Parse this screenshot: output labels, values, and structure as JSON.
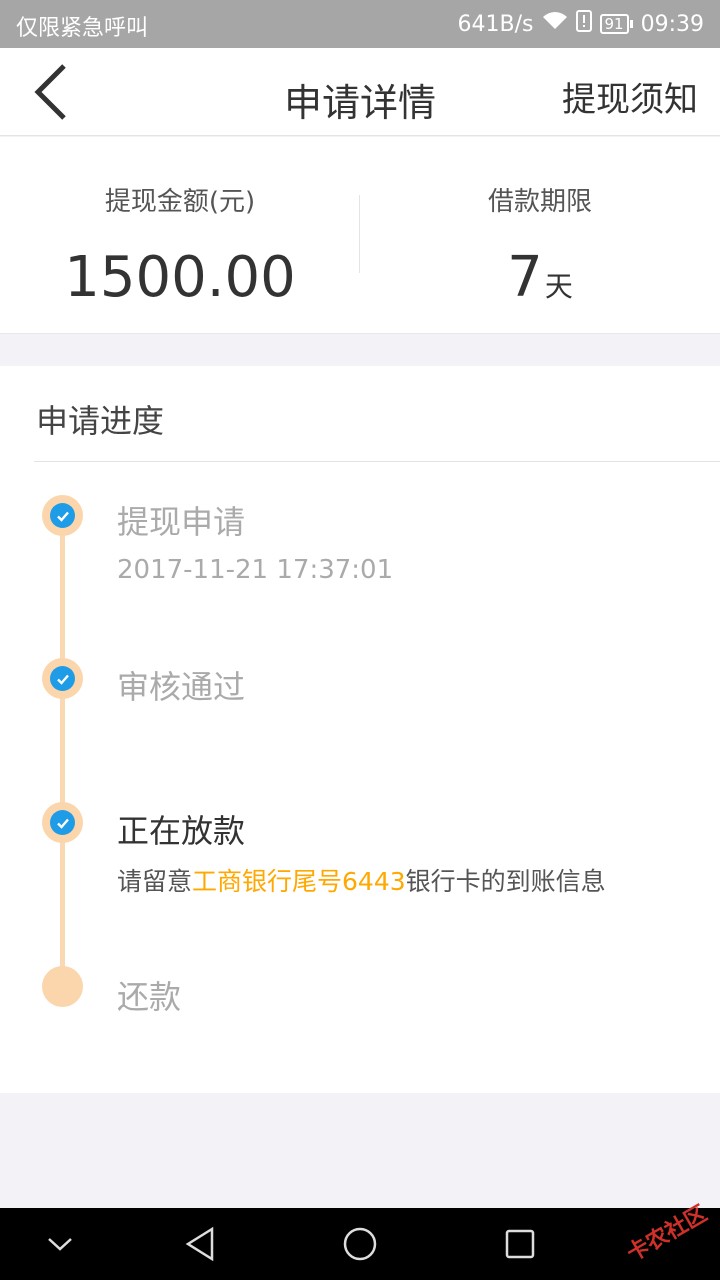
{
  "status_bar": {
    "carrier": "仅限紧急呼叫",
    "speed": "641B/s",
    "battery": "91",
    "time": "09:39"
  },
  "nav": {
    "title": "申请详情",
    "right_label": "提现须知"
  },
  "summary": {
    "amount_label": "提现金额(元)",
    "amount_value": "1500.00",
    "term_label": "借款期限",
    "term_value": "7",
    "term_unit": "天"
  },
  "progress": {
    "heading": "申请进度",
    "steps": [
      {
        "title": "提现申请",
        "subtitle": "2017-11-21 17:37:01",
        "done": true
      },
      {
        "title": "审核通过",
        "done": true
      },
      {
        "title": "正在放款",
        "note_prefix": "请留意",
        "note_highlight": "工商银行尾号6443",
        "note_suffix": "银行卡的到账信息",
        "done": true
      },
      {
        "title": "还款",
        "done": false
      }
    ]
  },
  "watermark": "卡农社区",
  "colors": {
    "accent_blue": "#1e9ce8",
    "timeline_peach": "#fad8b2",
    "highlight_orange": "#ffa800"
  }
}
